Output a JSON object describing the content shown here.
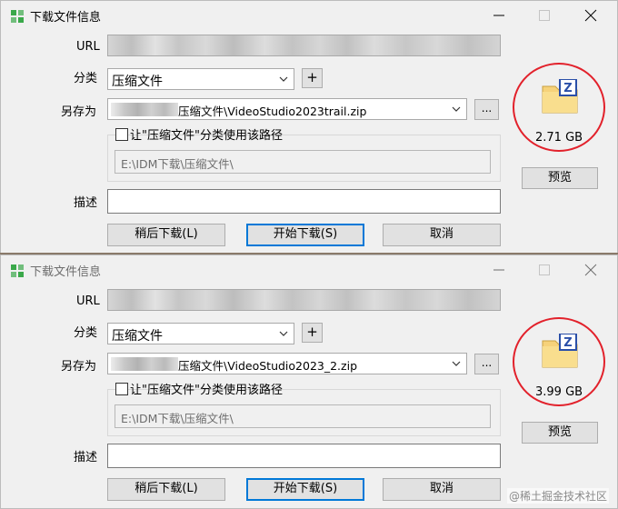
{
  "dialogs": [
    {
      "title": "下载文件信息",
      "labels": {
        "url": "URL",
        "category": "分类",
        "save_as": "另存为",
        "description": "描述"
      },
      "category_value": "压缩文件",
      "add_button": "+",
      "save_path_visible": "压缩文件\\VideoStudio2023trail.zip",
      "browse_button": "...",
      "checkbox_label": "让\"压缩文件\"分类使用该路径",
      "default_path": "E:\\IDM下载\\压缩文件\\",
      "file_size": "2.71 GB",
      "buttons": {
        "later": "稍后下载(L)",
        "start": "开始下载(S)",
        "cancel": "取消",
        "preview": "预览"
      }
    },
    {
      "title": "下载文件信息",
      "labels": {
        "url": "URL",
        "category": "分类",
        "save_as": "另存为",
        "description": "描述"
      },
      "category_value": "压缩文件",
      "add_button": "+",
      "save_path_visible": "压缩文件\\VideoStudio2023_2.zip",
      "browse_button": "...",
      "checkbox_label": "让\"压缩文件\"分类使用该路径",
      "default_path": "E:\\IDM下载\\压缩文件\\",
      "file_size": "3.99 GB",
      "buttons": {
        "later": "稍后下载(L)",
        "start": "开始下载(S)",
        "cancel": "取消",
        "preview": "预览"
      }
    }
  ],
  "watermark": "@稀土掘金技术社区",
  "colors": {
    "highlight_circle": "#e2212b",
    "default_button_border": "#0078d7",
    "file_icon_folder": "#f6d27a",
    "file_icon_badge": "#2a4fa8"
  },
  "icons": {
    "file_type": "zip-archive-icon",
    "app": "idm-app-icon"
  }
}
